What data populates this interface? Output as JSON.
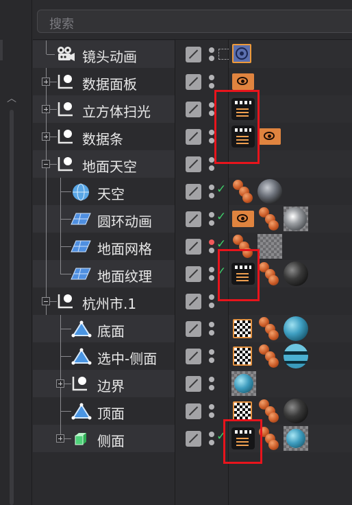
{
  "search": {
    "placeholder": "搜索"
  },
  "objects": [
    {
      "name": "镜头动画"
    },
    {
      "name": "数据面板"
    },
    {
      "name": "立方体扫光"
    },
    {
      "name": "数据条"
    },
    {
      "name": "地面天空"
    },
    {
      "name": "天空"
    },
    {
      "name": "圆环动画"
    },
    {
      "name": "地面网格"
    },
    {
      "name": "地面纹理"
    },
    {
      "name": "杭州市.1"
    },
    {
      "name": "底面"
    },
    {
      "name": "选中-侧面"
    },
    {
      "name": "边界"
    },
    {
      "name": "顶面"
    },
    {
      "name": "侧面"
    }
  ],
  "colors": {
    "highlight": "#e8141c",
    "check": "#3fcf6a",
    "tag_orange": "#e0843f"
  }
}
